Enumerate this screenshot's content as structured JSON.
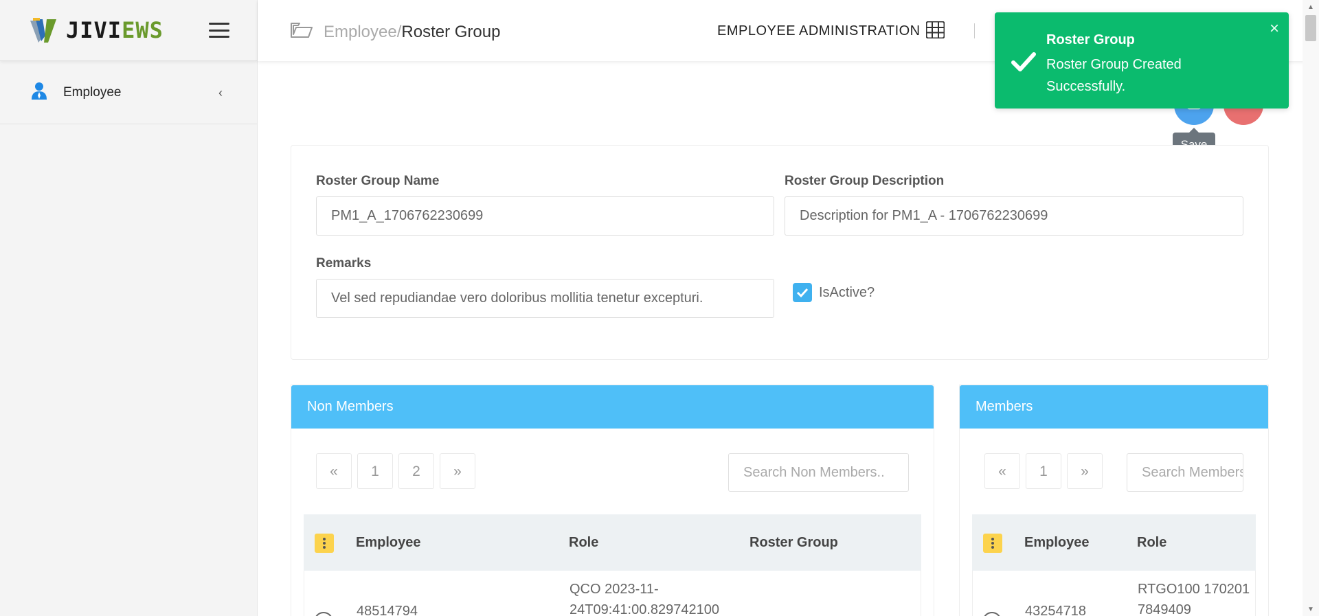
{
  "brand": {
    "part1": "JIVI",
    "part2": "EWS"
  },
  "sidebar": {
    "items": [
      {
        "label": "Employee"
      }
    ]
  },
  "header": {
    "breadcrumb_root": "Employee/",
    "breadcrumb_current": "Roster Group",
    "module_title": "EMPLOYEE ADMINISTRATION"
  },
  "actions": {
    "save_tooltip": "Save"
  },
  "toast": {
    "title": "Roster Group",
    "message": "Roster Group Created Successfully.",
    "close": "×",
    "color": "#0bbb6e"
  },
  "form": {
    "name_label": "Roster Group Name",
    "name_value": "PM1_A_1706762230699",
    "desc_label": "Roster Group Description",
    "desc_value": "Description for PM1_A - 1706762230699",
    "remarks_label": "Remarks",
    "remarks_value": "Vel sed repudiandae vero doloribus mollitia tenetur excepturi.",
    "isactive_label": "IsActive?",
    "isactive_checked": true
  },
  "non_members": {
    "title": "Non Members",
    "pager": [
      "«",
      "1",
      "2",
      "»"
    ],
    "search_placeholder": "Search Non Members..",
    "columns": [
      "Employee",
      "Role",
      "Roster Group"
    ],
    "rows": [
      {
        "employee": "48514794",
        "role": "QCO 2023-11-24T09:41:00.829742100",
        "roster_group": ""
      }
    ]
  },
  "members": {
    "title": "Members",
    "pager": [
      "«",
      "1",
      "»"
    ],
    "search_placeholder": "Search Members..",
    "columns": [
      "Employee",
      "Role"
    ],
    "rows": [
      {
        "employee": "43254718",
        "role": "RTGO100 1702017849409"
      }
    ]
  },
  "colors": {
    "panel_header": "#4fbff8",
    "save_button": "#4da3ee",
    "cancel_button": "#e87070",
    "brand_accent": "#6a9a2c"
  }
}
